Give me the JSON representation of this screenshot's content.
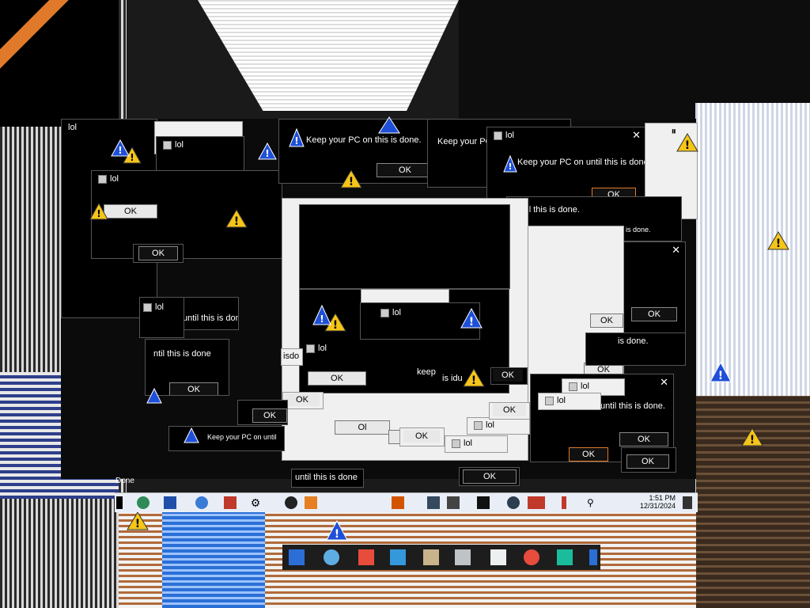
{
  "desktop": {
    "status_text": "Done"
  },
  "dialogs": [
    {
      "title": "lol",
      "message": "Keep your PC on until this is done.",
      "button": "OK"
    },
    {
      "title": "lol",
      "message": "Keep your PC on until this is done.",
      "button": "OK"
    },
    {
      "title": "lol",
      "message": "Keep your PC on until this is done.",
      "button": "OK"
    }
  ],
  "fragments": {
    "msg_a": "Keep your PC on this is done.",
    "msg_b": "until this is done.",
    "msg_c": "until this is done",
    "msg_d": "until this is done.",
    "msg_e": "is done.",
    "msg_f": "Keep your PC on until",
    "msg_g": "ntil this is done",
    "msg_h": "is done.",
    "msg_i": "isdo",
    "msg_j": "keep",
    "msg_k": "is idu"
  },
  "buttons": {
    "ok": "OK",
    "ok_glitch": "Ol",
    "ok_glitch2": "OK"
  },
  "titles": {
    "lol": "lol"
  },
  "taskbar": {
    "time": "1:51 PM",
    "date": "12/31/2024"
  },
  "colors": {
    "warning_yellow": "#f5c518",
    "info_blue": "#1e4fd8",
    "taskbar": "#e9eef6"
  }
}
